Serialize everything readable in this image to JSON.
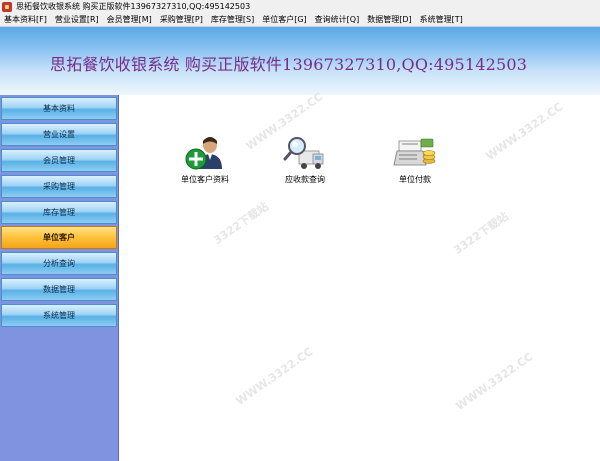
{
  "window": {
    "title": "思拓餐饮收银系统  购买正版软件13967327310,QQ:495142503"
  },
  "menu": [
    {
      "label": "基本资料[F]"
    },
    {
      "label": "营业设置[R]"
    },
    {
      "label": "会员管理[M]"
    },
    {
      "label": "采购管理[P]"
    },
    {
      "label": "库存管理[S]"
    },
    {
      "label": "单位客户[G]"
    },
    {
      "label": "查询统计[Q]"
    },
    {
      "label": "数据管理[D]"
    },
    {
      "label": "系统管理[T]"
    }
  ],
  "banner": {
    "text": "思拓餐饮收银系统  购买正版软件13967327310,QQ:495142503"
  },
  "sidebar": {
    "items": [
      {
        "label": "基本资料"
      },
      {
        "label": "营业设置"
      },
      {
        "label": "会员管理"
      },
      {
        "label": "采购管理"
      },
      {
        "label": "库存管理"
      },
      {
        "label": "单位客户",
        "active": true
      },
      {
        "label": "分析查询"
      },
      {
        "label": "数据管理"
      },
      {
        "label": "系统管理"
      }
    ]
  },
  "content": {
    "tiles": [
      {
        "label": "单位客户资料",
        "icon": "add-user-icon"
      },
      {
        "label": "应收款查询",
        "icon": "truck-search-icon"
      },
      {
        "label": "单位付款",
        "icon": "payment-register-icon"
      }
    ]
  },
  "watermark": {
    "text": "WWW.3322.CC",
    "sub": "3322下载站"
  },
  "colors": {
    "banner_text": "#7a2b8a",
    "sidebar_bg": "#7f93e0",
    "active_item": "#ffc23a"
  }
}
